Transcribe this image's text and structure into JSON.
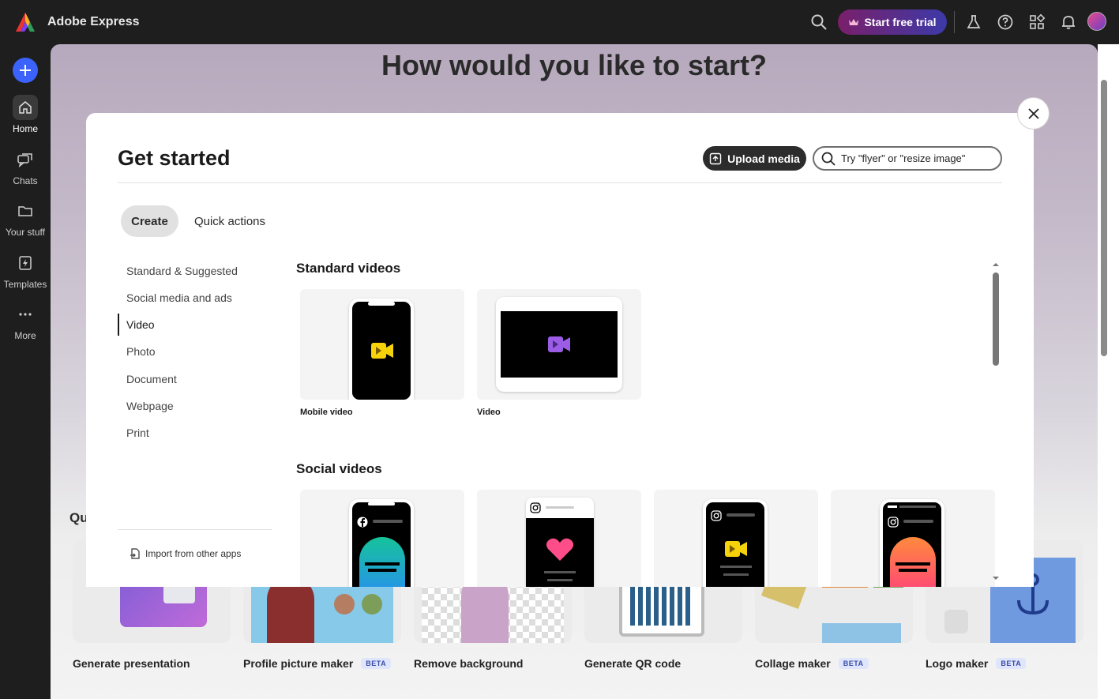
{
  "app": {
    "title": "Adobe Express",
    "trial_label": "Start free trial"
  },
  "rail": {
    "items": [
      {
        "label": "Home",
        "icon": "home-icon"
      },
      {
        "label": "Chats",
        "icon": "chat-icon"
      },
      {
        "label": "Your stuff",
        "icon": "folder-icon"
      },
      {
        "label": "Templates",
        "icon": "templates-icon"
      },
      {
        "label": "More",
        "icon": "more-icon"
      }
    ]
  },
  "background": {
    "heading": "How would you like to start?",
    "quick_prefix": "Qu",
    "cards": [
      {
        "label": "Generate presentation",
        "beta": ""
      },
      {
        "label": "Profile picture maker",
        "beta": "BETA"
      },
      {
        "label": "Remove background",
        "beta": ""
      },
      {
        "label": "Generate QR code",
        "beta": ""
      },
      {
        "label": "Collage maker",
        "beta": "BETA"
      },
      {
        "label": "Logo maker",
        "beta": "BETA"
      }
    ]
  },
  "modal": {
    "title": "Get started",
    "upload_label": "Upload media",
    "search_placeholder": "Try \"flyer\" or \"resize image\"",
    "tabs": [
      {
        "label": "Create"
      },
      {
        "label": "Quick actions"
      }
    ],
    "categories": [
      {
        "label": "Standard & Suggested"
      },
      {
        "label": "Social media and ads"
      },
      {
        "label": "Video"
      },
      {
        "label": "Photo"
      },
      {
        "label": "Document"
      },
      {
        "label": "Webpage"
      },
      {
        "label": "Print"
      }
    ],
    "import_label": "Import from other apps",
    "sections": [
      {
        "title": "Standard videos",
        "tiles": [
          {
            "label": "Mobile video"
          },
          {
            "label": "Video"
          }
        ]
      },
      {
        "title": "Social videos"
      }
    ]
  },
  "colors": {
    "accent": "#3b63fb",
    "trial_start": "#7a1f6a",
    "trial_end": "#3c3aa8",
    "video_yellow": "#f5d20a",
    "video_purple": "#9b5de5"
  }
}
